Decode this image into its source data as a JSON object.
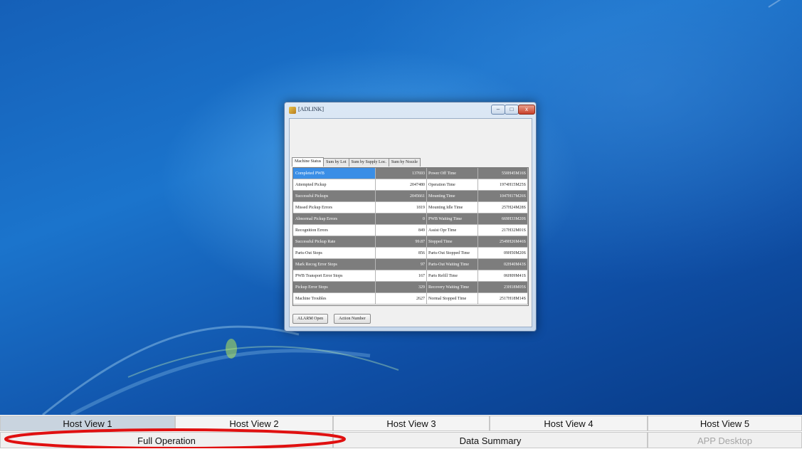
{
  "window": {
    "title": "[ADLINK]",
    "minimize_glyph": "–",
    "maximize_glyph": "□",
    "close_glyph": "x",
    "tabs": [
      "Machine Status",
      "Sum by Lot",
      "Sum by Supply Loc.",
      "Sum by Nozzle"
    ],
    "active_tab": "Machine Status",
    "rows": [
      {
        "label": "Completed PWB",
        "value": "137693",
        "label2": "Power Off Time",
        "value2": "550H45M16S",
        "shade": "dark",
        "selected": true
      },
      {
        "label": "Attempted Pickup",
        "value": "2047480",
        "label2": "Operation Time",
        "value2": "1974H15M25S",
        "shade": "light",
        "selected": false
      },
      {
        "label": "Successful Pickups",
        "value": "2045661",
        "label2": "Mounting Time",
        "value2": "1047H17M26S",
        "shade": "dark",
        "selected": false
      },
      {
        "label": "Missed Pickup Errors",
        "value": "1819",
        "label2": "Mounting Idle Time",
        "value2": "257H24M28S",
        "shade": "light",
        "selected": false
      },
      {
        "label": "Abnormal Pickup Errors",
        "value": "0",
        "label2": "PWB Waiting Time",
        "value2": "669H33M20S",
        "shade": "dark",
        "selected": false
      },
      {
        "label": "Recognition Errors",
        "value": "849",
        "label2": "Assist Opr Time",
        "value2": "217H32M01S",
        "shade": "light",
        "selected": false
      },
      {
        "label": "Successful Pickup Rate",
        "value": "99.87",
        "label2": "Stopped Time",
        "value2": "2549H26M46S",
        "shade": "dark",
        "selected": false
      },
      {
        "label": "Parts-Out Stops",
        "value": "856",
        "label2": "Parts-Out Stopped Time",
        "value2": "09H50M20S",
        "shade": "light",
        "selected": false
      },
      {
        "label": "Mark Recog Error Stops",
        "value": "97",
        "label2": "Parts-Out Waiting Time",
        "value2": "02H40M43S",
        "shade": "dark",
        "selected": false
      },
      {
        "label": "PWB Transport Error Stops",
        "value": "167",
        "label2": "Parts Refill Time",
        "value2": "06H09M41S",
        "shade": "light",
        "selected": false
      },
      {
        "label": "Pickup Error Stops",
        "value": "329",
        "label2": "Recovery Waiting Time",
        "value2": "23H18M05S",
        "shade": "dark",
        "selected": false
      },
      {
        "label": "Machine Troubles",
        "value": "2627",
        "label2": "Normal Stopped Time",
        "value2": "2517H18M14S",
        "shade": "light",
        "selected": false
      }
    ],
    "buttons": {
      "alarm": "ALARM Open",
      "action": "Action Number"
    }
  },
  "host_views": [
    "Host View 1",
    "Host View 2",
    "Host View 3",
    "Host View 4",
    "Host View 5"
  ],
  "operations": {
    "full": "Full Operation",
    "summary": "Data Summary",
    "desktop": "APP Desktop"
  },
  "colors": {
    "highlight": "#e01010",
    "selected_row": "#3a8ee6",
    "dark_row": "#7d7d7d",
    "desktop_blue": "#1b74cc"
  },
  "icons": {
    "app": "app-icon",
    "minimize": "minimize-icon",
    "maximize": "maximize-icon",
    "close": "close-icon"
  }
}
